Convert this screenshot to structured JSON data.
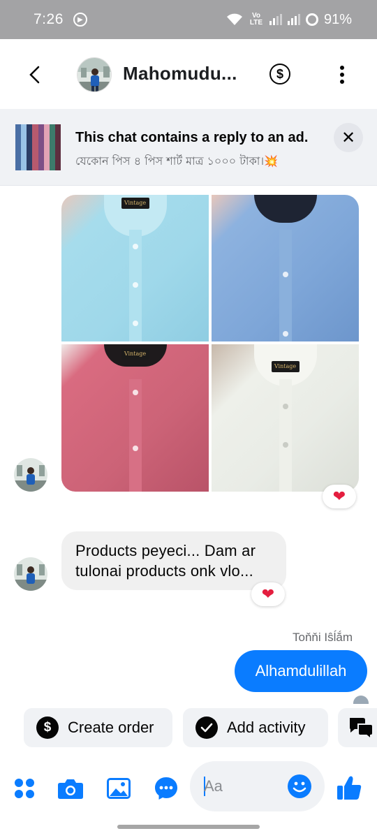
{
  "status_bar": {
    "time": "7:26",
    "network_label": "Vo LTE",
    "battery": "91%"
  },
  "header": {
    "contact_name": "Mahomudu..."
  },
  "ad_banner": {
    "title": "This chat contains a reply to an ad.",
    "subtitle": "যেকোন পিস ৪ পিস শার্ট মাত্র ১০০০ টাকা।💥"
  },
  "messages": [
    {
      "type": "photo_grid",
      "direction": "incoming",
      "photos": [
        {
          "name": "light-blue-shirt",
          "color": "#9fd8ea",
          "label": "Vintage"
        },
        {
          "name": "blue-shirt",
          "color": "#7ea6d8",
          "label": ""
        },
        {
          "name": "red-shirt",
          "color": "#cc6377",
          "label": "Vintage"
        },
        {
          "name": "white-shirt",
          "color": "#e9ece6",
          "label": "Vintage"
        }
      ],
      "reaction": "❤"
    },
    {
      "type": "text",
      "direction": "incoming",
      "text_line1": "Products peyeci... Dam ar",
      "text_line2": "tulonai products onk vlo...",
      "reaction": "❤"
    },
    {
      "type": "text",
      "direction": "outgoing",
      "sender": "Toňňi Iŝĺắm",
      "text": "Alhamdulillah"
    }
  ],
  "quick_actions": [
    {
      "label": "Create order",
      "icon": "dollar-icon"
    },
    {
      "label": "Add activity",
      "icon": "check-icon"
    }
  ],
  "composer": {
    "placeholder": "Aa"
  },
  "colors": {
    "accent": "#0a7cff",
    "status_bar_bg": "#a3a3a5",
    "bubble_in": "#f0f0f0",
    "reaction_red": "#e41e3f"
  }
}
